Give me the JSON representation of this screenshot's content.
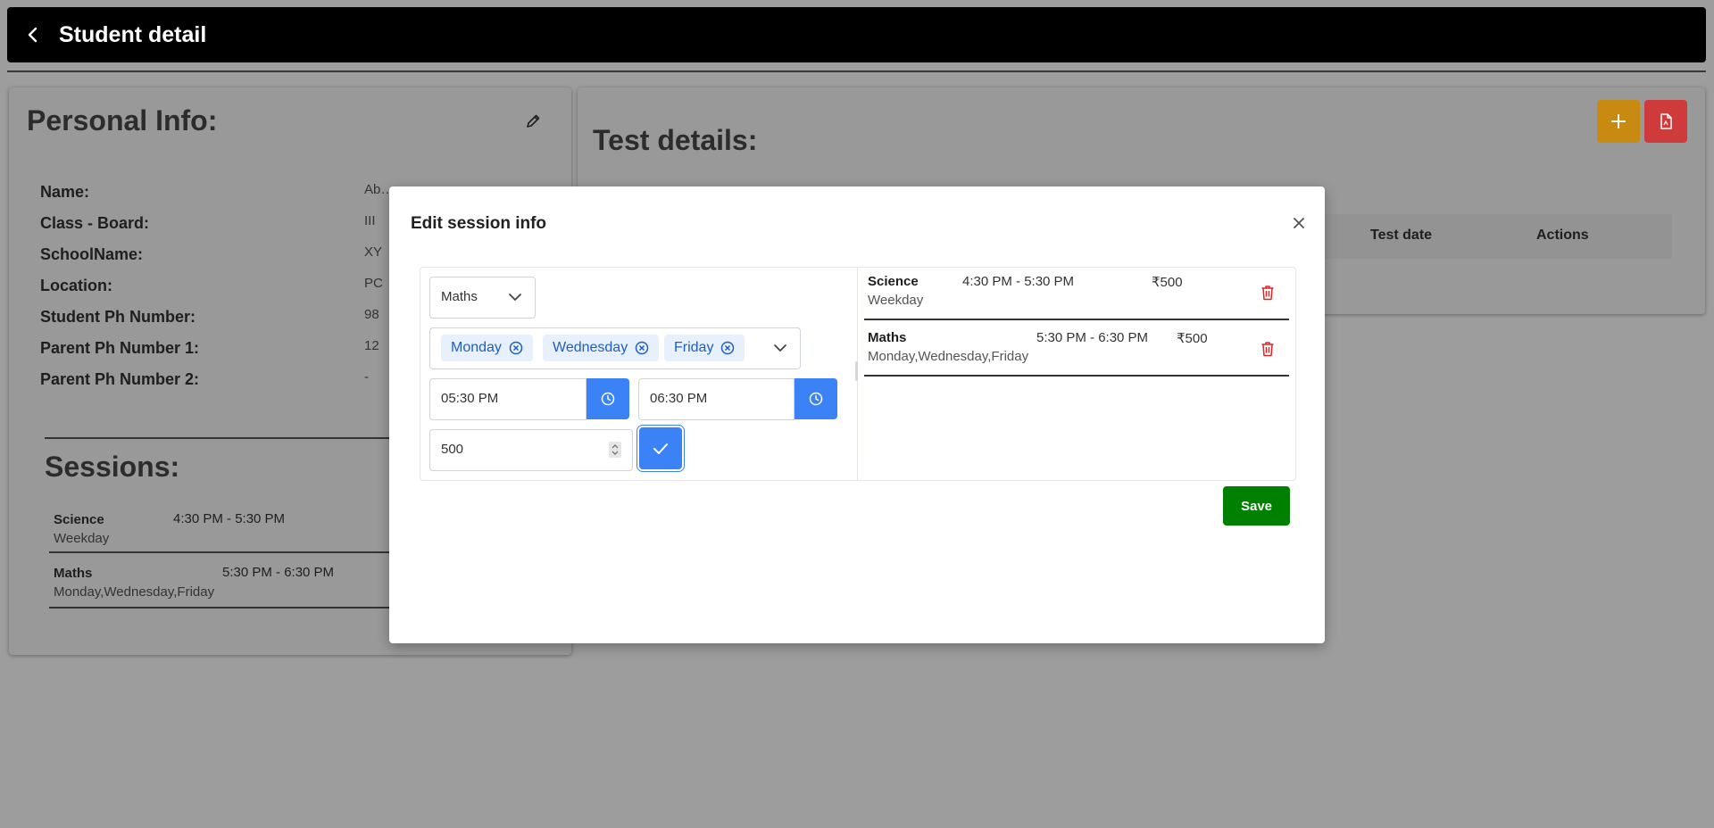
{
  "header": {
    "title": "Student detail"
  },
  "personal": {
    "heading": "Personal Info:",
    "rows": [
      {
        "label": "Name:",
        "value": "Ab…"
      },
      {
        "label": "Class - Board:",
        "value": "III"
      },
      {
        "label": "SchoolName:",
        "value": "XY"
      },
      {
        "label": "Location:",
        "value": "PC"
      },
      {
        "label": "Student Ph Number:",
        "value": "98"
      },
      {
        "label": "Parent Ph Number 1:",
        "value": "12"
      },
      {
        "label": "Parent Ph Number 2:",
        "value": "-"
      }
    ]
  },
  "sessions": {
    "heading": "Sessions:",
    "items": [
      {
        "subject": "Science",
        "time": "4:30 PM - 5:30 PM",
        "days": "Weekday"
      },
      {
        "subject": "Maths",
        "time": "5:30 PM - 6:30 PM",
        "days": "Monday,Wednesday,Friday"
      }
    ]
  },
  "tests": {
    "heading": "Test details:",
    "columns": [
      "Test date",
      "Actions"
    ],
    "colors": {
      "add": "#c98a12",
      "pdf": "#cf3a3a"
    }
  },
  "modal": {
    "title": "Edit session info",
    "subject_value": "Maths",
    "days": [
      "Monday",
      "Wednesday",
      "Friday"
    ],
    "start_time": "05:30 PM",
    "end_time": "06:30 PM",
    "fee_value": "500",
    "save_label": "Save",
    "sessions": [
      {
        "subject": "Science",
        "time": "4:30 PM - 5:30 PM",
        "price": "₹500",
        "days": "Weekday"
      },
      {
        "subject": "Maths",
        "time": "5:30 PM - 6:30 PM",
        "price": "₹500",
        "days": "Monday,Wednesday,Friday"
      }
    ]
  }
}
